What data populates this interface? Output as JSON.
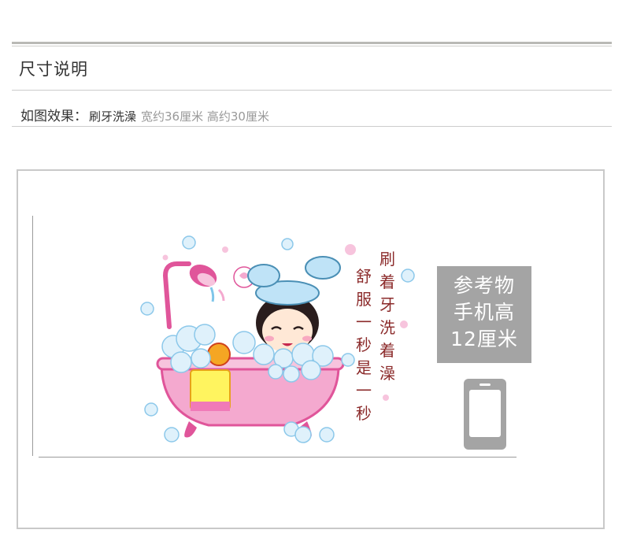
{
  "section": {
    "title": "尺寸说明"
  },
  "effect": {
    "label": "如图效果：",
    "name": "刷牙洗澡",
    "dims": "宽约36厘米 高约30厘米"
  },
  "slogan": {
    "col_right": [
      "刷",
      "着",
      "牙",
      "洗",
      "着",
      "澡"
    ],
    "col_left": [
      "舒",
      "服",
      "一",
      "秒",
      "是",
      "一",
      "秒"
    ]
  },
  "reference": {
    "line1": "参考物",
    "line2": "手机高",
    "line3": "12厘米"
  },
  "colors": {
    "tub_pink": "#f4a9cf",
    "tub_dark": "#e0559a",
    "bubble_blue": "#bfe3f7",
    "slogan_text": "#8b2a2a",
    "ref_gray": "#a4a4a4"
  },
  "icons": [
    "bathtub-icon",
    "shower-head-icon",
    "phone-icon"
  ]
}
